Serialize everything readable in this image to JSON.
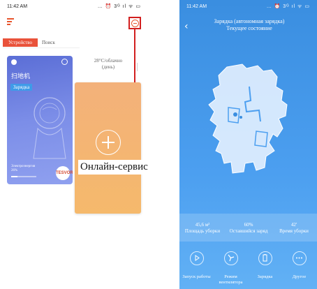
{
  "left_phone": {
    "status_time": "11:42 AM",
    "status_icons": "… ⏰ 3ᴳ ıl ᯤ ▭",
    "tabs": [
      {
        "label": "Устройство",
        "active": true
      },
      {
        "label": "Поиск",
        "active": false
      }
    ],
    "device_card": {
      "name": "扫地机",
      "status_badge": "Зарядка",
      "battery_label": "Электроэнергия",
      "battery_value": "26%",
      "battery_level": 0.26,
      "logo": "TESVOR"
    },
    "weather": {
      "temp": "28°C/облачно",
      "period": "(день)"
    },
    "online_service_label": "Онлайн-сервис"
  },
  "right_phone": {
    "status_time": "11:42 AM",
    "status_icons": "… ⏰ 3ᴳ ıl ᯤ ▭",
    "title_line1": "Зарядка (автономная зарядка)",
    "title_line2": "Текущее состояние",
    "stats": [
      {
        "value": "45,6 м²",
        "label": "Площадь уборки"
      },
      {
        "value": "60%",
        "label": "Оставшийся заряд"
      },
      {
        "value": "42'",
        "label": "Время уборки"
      }
    ],
    "controls": [
      {
        "icon": "play-icon",
        "label": "Запуск работы"
      },
      {
        "icon": "fan-icon",
        "label": "Режим вентилятора"
      },
      {
        "icon": "battery-icon",
        "label": "Зарядка"
      },
      {
        "icon": "more-icon",
        "label": "Другое"
      }
    ]
  },
  "colors": {
    "accent": "#e9523a",
    "highlight": "#d21f1f",
    "map_bg": "#4c9ff0",
    "card": "#6f81e3",
    "add_card": "#f4b472"
  }
}
